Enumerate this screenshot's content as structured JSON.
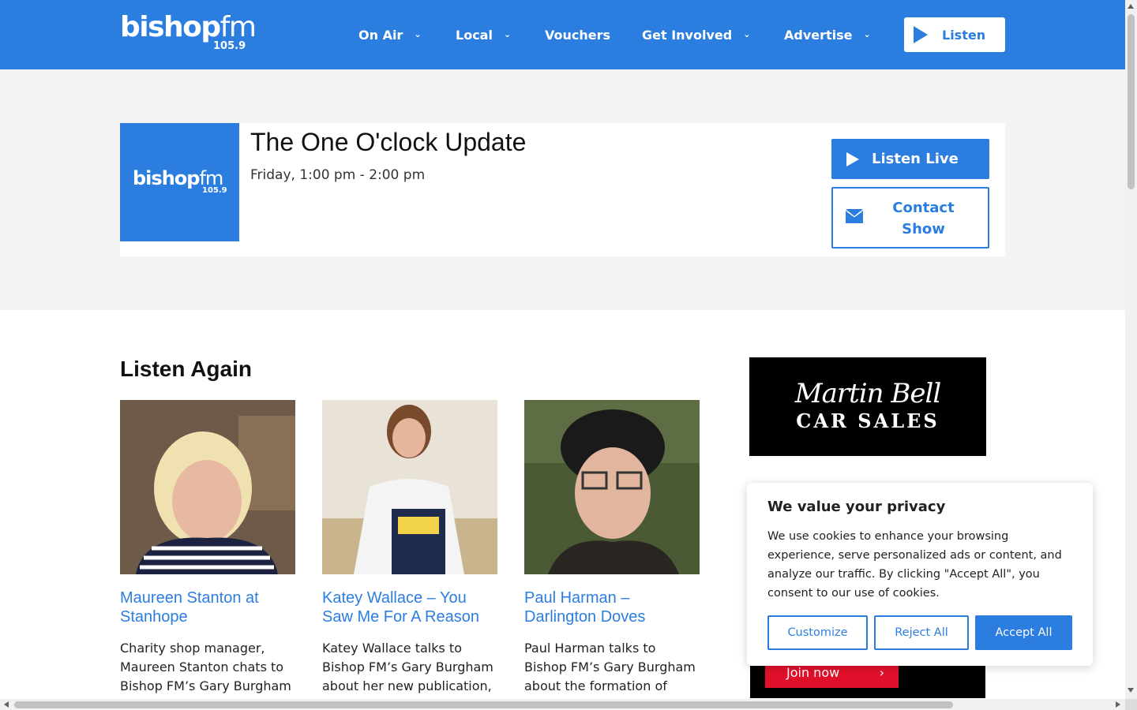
{
  "brand": {
    "name_bold": "bishop",
    "name_light": "fm",
    "frequency": "105.9",
    "accent": "#2b7ee0"
  },
  "nav": [
    {
      "label": "On Air",
      "has_dropdown": true
    },
    {
      "label": "Local",
      "has_dropdown": true
    },
    {
      "label": "Vouchers",
      "has_dropdown": false
    },
    {
      "label": "Get Involved",
      "has_dropdown": true
    },
    {
      "label": "Advertise",
      "has_dropdown": true
    }
  ],
  "header_listen": "Listen",
  "show": {
    "title": "The One O'clock Update",
    "time": "Friday, 1:00 pm - 2:00 pm",
    "listen_live": "Listen Live",
    "contact": "Contact Show"
  },
  "listen_again": {
    "heading": "Listen Again",
    "items": [
      {
        "title": "Maureen Stanton at Stanhope",
        "desc": "Charity shop manager, Maureen Stanton chats to Bishop FM’s Gary Burgham"
      },
      {
        "title": "Katey Wallace – You Saw Me For A Reason",
        "desc": "Katey Wallace talks to Bishop FM’s Gary Burgham about her new publication,"
      },
      {
        "title": "Paul Harman – Darlington Doves",
        "desc": "Paul Harman talks to Bishop FM’s Gary Burgham about the formation of"
      }
    ]
  },
  "ads": {
    "martin_bell_line1": "Martin Bell",
    "martin_bell_line2": "CAR SALES",
    "join": "Join now"
  },
  "cookie": {
    "title": "We value your privacy",
    "body": "We use cookies to enhance your browsing experience, serve personalized ads or content, and analyze our traffic. By clicking \"Accept All\", you consent to our use of cookies.",
    "customize": "Customize",
    "reject": "Reject All",
    "accept": "Accept All"
  }
}
